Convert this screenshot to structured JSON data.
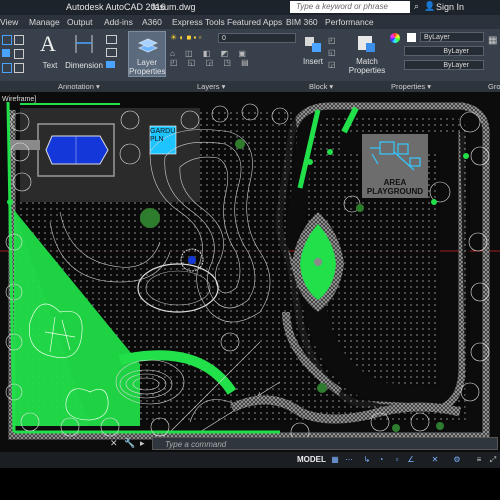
{
  "titlebar": {
    "app_name": "Autodesk AutoCAD 2016",
    "document": "fasum.dwg",
    "search_placeholder": "Type a keyword or phrase",
    "sign_in": "Sign In"
  },
  "menubar": {
    "items": [
      "View",
      "Manage",
      "Output",
      "Add-ins",
      "A360",
      "Express Tools",
      "Featured Apps",
      "BIM 360",
      "Performance"
    ]
  },
  "ribbon": {
    "text_label": "Text",
    "dimension_label": "Dimension",
    "layer_properties_label": "Layer Properties",
    "insert_label": "Insert",
    "match_properties_label": "Match Properties",
    "layer_combo": "0",
    "bylayer_1": "ByLayer",
    "bylayer_2": "ByLayer",
    "bylayer_3": "ByLayer"
  },
  "panels": {
    "annotation": "Annotation ▾",
    "layers": "Layers ▾",
    "block": "Block ▾",
    "properties": "Properties ▾",
    "groups": "Gro"
  },
  "viewport": {
    "label": "Wireframe]",
    "gardu_label": "GARDU PLN",
    "playground_label_1": "AREA",
    "playground_label_2": "PLAYGROUND"
  },
  "command": {
    "placeholder": "Type a command"
  },
  "status": {
    "model_label": "MODEL"
  },
  "colors": {
    "accent_blue": "#2a7bd4",
    "plan_green": "#22e04a",
    "pool_blue": "#1437d9"
  }
}
